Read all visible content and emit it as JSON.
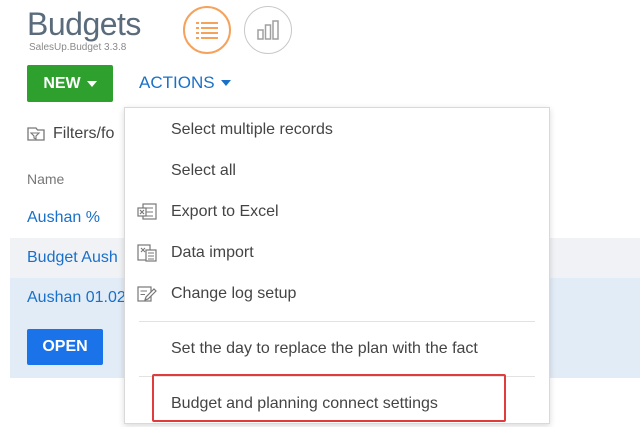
{
  "header": {
    "title": "Budgets",
    "subtitle": "SalesUp.Budget 3.3.8"
  },
  "toolbar": {
    "new_label": "NEW",
    "actions_label": "ACTIONS"
  },
  "filters": {
    "label": "Filters/fo"
  },
  "grid": {
    "column_name": "Name",
    "rows": [
      {
        "name": "Aushan %"
      },
      {
        "name": "Budget Aush"
      },
      {
        "name": "Aushan 01.02"
      }
    ],
    "open_label": "OPEN"
  },
  "actions_menu": {
    "items": [
      {
        "label": "Select multiple records",
        "icon": ""
      },
      {
        "label": "Select all",
        "icon": ""
      },
      {
        "label": "Export to Excel",
        "icon": "excel-export-icon"
      },
      {
        "label": "Data import",
        "icon": "data-import-icon"
      },
      {
        "label": "Change log setup",
        "icon": "change-log-icon"
      },
      {
        "label": "Set the day to replace the plan with the fact",
        "icon": ""
      },
      {
        "label": "Budget and planning connect settings",
        "icon": ""
      }
    ]
  },
  "colors": {
    "new_button": "#2ea02e",
    "link": "#1a70c8",
    "open_button": "#1a73e8",
    "list_view_ring": "#f5a35c",
    "highlight": "#e03c3c"
  }
}
